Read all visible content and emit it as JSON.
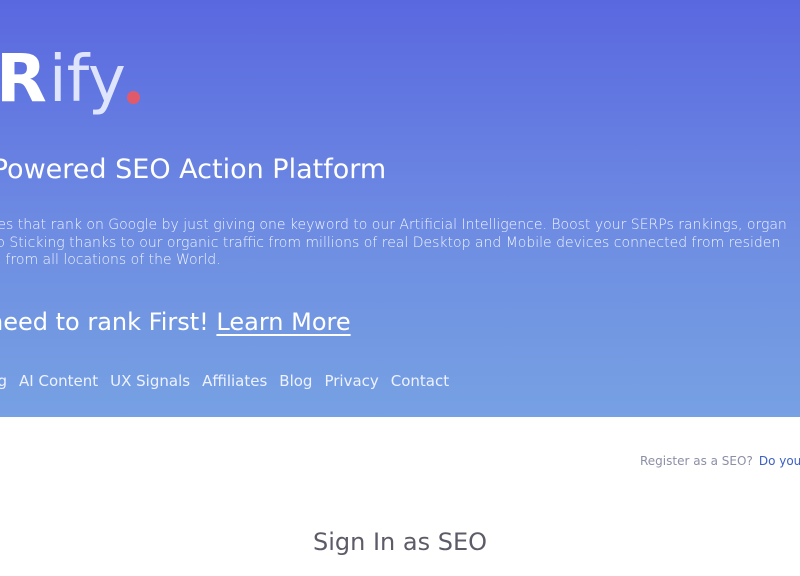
{
  "hero": {
    "logo": {
      "strong": "R",
      "light": "ify",
      "accent_color": "#e15a6c"
    },
    "headline": "-Powered SEO Action Platform",
    "description_lines": [
      "ites that rank on Google by just giving one keyword to our Artificial Intelligence. Boost your SERPs rankings, organ",
      "go Sticking thanks to our organic traffic from millions of real Desktop and Mobile devices connected from residen",
      "rs from all locations of the World."
    ],
    "cta": {
      "text": "need to rank First!",
      "link": "Learn More"
    },
    "nav": [
      "ng",
      "AI Content",
      "UX Signals",
      "Affiliates",
      "Blog",
      "Privacy",
      "Contact"
    ],
    "gradient": {
      "top": "#5a68e0",
      "bottom": "#76a1e3"
    }
  },
  "register": {
    "prompt": "Register as a SEO?",
    "link": "Do you"
  },
  "signin": {
    "title": "Sign In as SEO"
  }
}
